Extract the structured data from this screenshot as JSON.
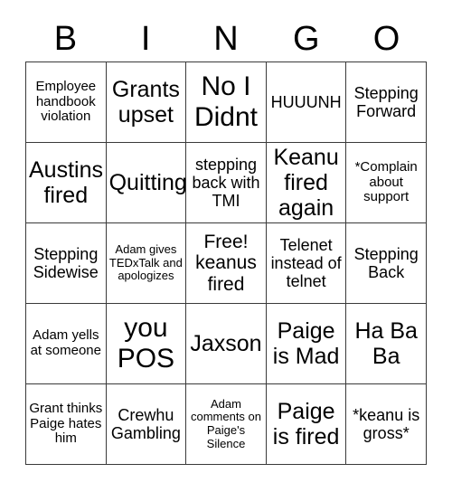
{
  "header": {
    "letters": [
      "B",
      "I",
      "N",
      "G",
      "O"
    ]
  },
  "grid": {
    "columns": 5,
    "rows": 5,
    "cells": [
      {
        "text": "Employee handbook violation",
        "size": "fs-sm"
      },
      {
        "text": "Grants upset",
        "size": "fs-xl"
      },
      {
        "text": "No I Didnt",
        "size": "fs-xxl"
      },
      {
        "text": "HUUUNH",
        "size": "fs-md"
      },
      {
        "text": "Stepping Forward",
        "size": "fs-md"
      },
      {
        "text": "Austins fired",
        "size": "fs-xl"
      },
      {
        "text": "Quitting",
        "size": "fs-xl"
      },
      {
        "text": "stepping back with TMI",
        "size": "fs-md"
      },
      {
        "text": "Keanu fired again",
        "size": "fs-xl"
      },
      {
        "text": "*Complain about support",
        "size": "fs-sm"
      },
      {
        "text": "Stepping Sidewise",
        "size": "fs-md"
      },
      {
        "text": "Adam gives TEDxTalk and apologizes",
        "size": "fs-xs"
      },
      {
        "text": "Free! keanus fired",
        "size": "fs-lg"
      },
      {
        "text": "Telenet instead of telnet",
        "size": "fs-md"
      },
      {
        "text": "Stepping Back",
        "size": "fs-md"
      },
      {
        "text": "Adam yells at someone",
        "size": "fs-sm"
      },
      {
        "text": "you POS",
        "size": "fs-xxl"
      },
      {
        "text": "Jaxson",
        "size": "fs-xl"
      },
      {
        "text": "Paige is Mad",
        "size": "fs-xl"
      },
      {
        "text": "Ha Ba Ba",
        "size": "fs-xl"
      },
      {
        "text": "Grant thinks Paige hates him",
        "size": "fs-sm"
      },
      {
        "text": "Crewhu Gambling",
        "size": "fs-md"
      },
      {
        "text": "Adam comments on Paige's Silence",
        "size": "fs-xs"
      },
      {
        "text": "Paige is fired",
        "size": "fs-xl"
      },
      {
        "text": "*keanu is gross*",
        "size": "fs-md"
      }
    ]
  },
  "colors": {
    "background": "#ffffff",
    "text": "#000000",
    "border": "#3a3a3a"
  }
}
